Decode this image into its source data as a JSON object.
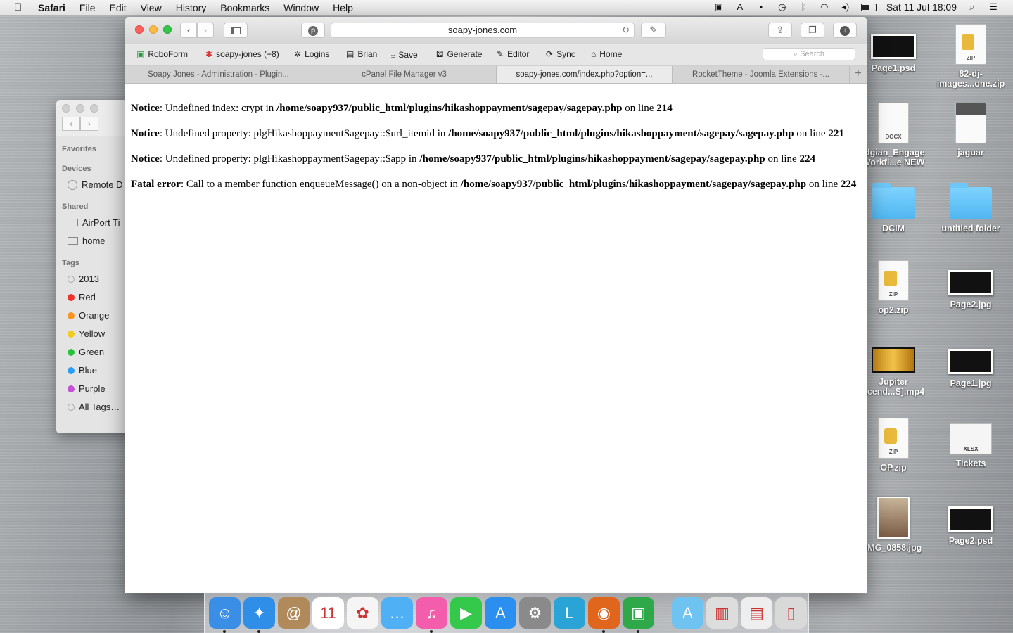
{
  "menubar": {
    "app": "Safari",
    "items": [
      "File",
      "Edit",
      "View",
      "History",
      "Bookmarks",
      "Window",
      "Help"
    ],
    "clock": "Sat 11 Jul  18:09"
  },
  "finder": {
    "sections": {
      "favorites": "Favorites",
      "devices": "Devices",
      "shared": "Shared",
      "tags": "Tags"
    },
    "devices": [
      "Remote D"
    ],
    "shared": [
      "AirPort Ti",
      "home"
    ],
    "tags": [
      {
        "label": "2013",
        "color": "#e4e4e4"
      },
      {
        "label": "Red",
        "color": "#f0322c"
      },
      {
        "label": "Orange",
        "color": "#f6961e"
      },
      {
        "label": "Yellow",
        "color": "#f2cc1b"
      },
      {
        "label": "Green",
        "color": "#29c33b"
      },
      {
        "label": "Blue",
        "color": "#2a9df4"
      },
      {
        "label": "Purple",
        "color": "#c451d6"
      },
      {
        "label": "All Tags…",
        "color": "#e4e4e4"
      }
    ]
  },
  "safari": {
    "url": "soapy-jones.com",
    "bookmarks": [
      {
        "label": "RoboForm",
        "icon": "roboform-icon"
      },
      {
        "label": "soapy-jones (+8)",
        "icon": "joomla-icon"
      },
      {
        "label": "Logins",
        "icon": "logins-icon"
      },
      {
        "label": "Brian",
        "icon": "contact-icon"
      },
      {
        "label": "Save",
        "icon": "save-icon"
      },
      {
        "label": "Generate",
        "icon": "generate-icon"
      },
      {
        "label": "Editor",
        "icon": "editor-icon"
      },
      {
        "label": "Sync",
        "icon": "sync-icon"
      },
      {
        "label": "Home",
        "icon": "home-icon"
      }
    ],
    "search_placeholder": "Search",
    "tabs": [
      {
        "label": "Soapy Jones - Administration - Plugin..."
      },
      {
        "label": "cPanel File Manager v3"
      },
      {
        "label": "soapy-jones.com/index.php?option=..."
      },
      {
        "label": "RocketTheme - Joomla Extensions -..."
      }
    ]
  },
  "errors": [
    {
      "type": "Notice",
      "message": ": Undefined index: crypt in ",
      "path": "/home/soapy937/public_html/plugins/hikashoppayment/sagepay/sagepay.php",
      "mid": " on line ",
      "line": "214"
    },
    {
      "type": "Notice",
      "message": ": Undefined property: plgHikashoppaymentSagepay::$url_itemid in ",
      "path": "/home/soapy937/public_html/plugins/hikashoppayment/sagepay/sagepay.php",
      "mid": " on line ",
      "line": "221"
    },
    {
      "type": "Notice",
      "message": ": Undefined property: plgHikashoppaymentSagepay::$app in ",
      "path": "/home/soapy937/public_html/plugins/hikashoppayment/sagepay/sagepay.php",
      "mid": " on line ",
      "line": "224"
    },
    {
      "type": "Fatal error",
      "message": ": Call to a member function enqueueMessage() on a non-object in ",
      "path": "/home/soapy937/public_html/plugins/hikashoppayment/sagepay/sagepay.php",
      "mid": " on line ",
      "line": "224"
    }
  ],
  "desktop": [
    {
      "label": "Page1.psd",
      "kind": "image"
    },
    {
      "label": "82-dj-\nimages...one.zip",
      "kind": "zip"
    },
    {
      "label": "idgian_Engage\nWorkfl...e NEW",
      "kind": "docx"
    },
    {
      "label": "jaguar",
      "kind": "doc"
    },
    {
      "label": "DCIM",
      "kind": "folder"
    },
    {
      "label": "untitled folder",
      "kind": "folder"
    },
    {
      "label": "op2.zip",
      "kind": "zip"
    },
    {
      "label": "Page2.jpg",
      "kind": "image"
    },
    {
      "label": "Jupiter\nscend...S].mp4",
      "kind": "video"
    },
    {
      "label": "Page1.jpg",
      "kind": "image"
    },
    {
      "label": "OP.zip",
      "kind": "zip"
    },
    {
      "label": "Tickets",
      "kind": "sheet"
    },
    {
      "label": "IMG_0858.jpg",
      "kind": "photo"
    },
    {
      "label": "Page2.psd",
      "kind": "image"
    }
  ],
  "dock": [
    {
      "name": "finder-icon",
      "color": "#3a8ee6"
    },
    {
      "name": "safari-icon",
      "color": "#2f8ee8"
    },
    {
      "name": "contacts-icon",
      "color": "#b08a5a"
    },
    {
      "name": "calendar-icon",
      "color": "#ffffff"
    },
    {
      "name": "photos-icon",
      "color": "#f5f5f5"
    },
    {
      "name": "messages-icon",
      "color": "#4fb0f5"
    },
    {
      "name": "itunes-icon",
      "color": "#f35dab"
    },
    {
      "name": "facetime-icon",
      "color": "#35c94c"
    },
    {
      "name": "app-store-icon",
      "color": "#2b8ff0"
    },
    {
      "name": "system-preferences-icon",
      "color": "#8a8a8a"
    },
    {
      "name": "lync-icon",
      "color": "#2aa3d6"
    },
    {
      "name": "firefox-icon",
      "color": "#e0661d"
    },
    {
      "name": "roboform-icon",
      "color": "#2fa84a"
    },
    {
      "name": "applications-folder-icon",
      "color": "#6fc3f1"
    },
    {
      "name": "downloads-stack-icon",
      "color": "#dddddd"
    },
    {
      "name": "documents-stack-icon",
      "color": "#eeeeee"
    },
    {
      "name": "trash-icon",
      "color": "#d9d9d9"
    }
  ]
}
